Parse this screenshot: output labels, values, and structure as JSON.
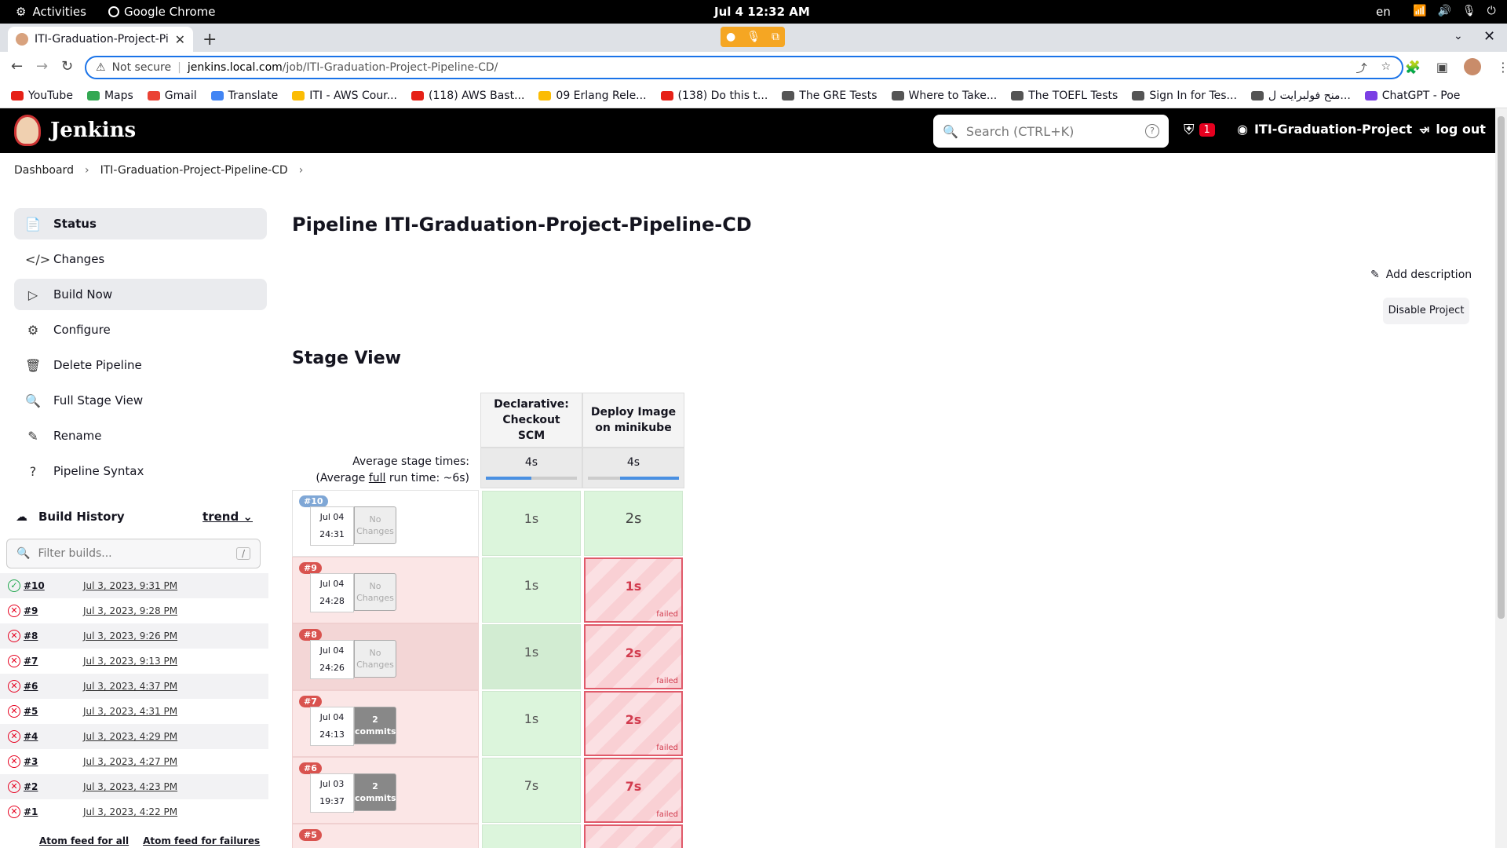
{
  "os_bar": {
    "activities": "Activities",
    "app_name": "Google Chrome",
    "clock": "Jul 4  12:32 AM",
    "lang": "en"
  },
  "browser": {
    "tab_title": "ITI-Graduation-Project-Pi",
    "url_warning": "Not secure",
    "url_host": "jenkins.local.com",
    "url_path": "/job/ITI-Graduation-Project-Pipeline-CD/",
    "bookmarks": [
      {
        "label": "YouTube",
        "color": "#e62117"
      },
      {
        "label": "Maps",
        "color": "#34a853"
      },
      {
        "label": "Gmail",
        "color": "#ea4335"
      },
      {
        "label": "Translate",
        "color": "#4285f4"
      },
      {
        "label": "ITI - AWS Cour...",
        "color": "#fbbc04"
      },
      {
        "label": "(118) AWS Bast...",
        "color": "#e62117"
      },
      {
        "label": "09 Erlang Rele...",
        "color": "#fbbc04"
      },
      {
        "label": "(138) Do this t...",
        "color": "#e62117"
      },
      {
        "label": "The GRE Tests",
        "color": "#555555"
      },
      {
        "label": "Where to Take...",
        "color": "#555555"
      },
      {
        "label": "The TOEFL Tests",
        "color": "#555555"
      },
      {
        "label": "Sign In for Tes...",
        "color": "#555555"
      },
      {
        "label": "منح فولبرايت ل...",
        "color": "#555555"
      },
      {
        "label": "ChatGPT - Poe",
        "color": "#7b3fe4"
      }
    ]
  },
  "jenkins": {
    "brand": "Jenkins",
    "search_placeholder": "Search (CTRL+K)",
    "alert_count": "1",
    "user": "ITI-Graduation-Project",
    "logout": "log out",
    "breadcrumbs": [
      "Dashboard",
      "ITI-Graduation-Project-Pipeline-CD"
    ],
    "tasks": [
      {
        "label": "Status",
        "icon": "📄"
      },
      {
        "label": "Changes",
        "icon": "</>"
      },
      {
        "label": "Build Now",
        "icon": "▷"
      },
      {
        "label": "Configure",
        "icon": "⚙"
      },
      {
        "label": "Delete Pipeline",
        "icon": "🗑"
      },
      {
        "label": "Full Stage View",
        "icon": "🔍"
      },
      {
        "label": "Rename",
        "icon": "✎"
      },
      {
        "label": "Pipeline Syntax",
        "icon": "?"
      }
    ],
    "build_history": {
      "title": "Build History",
      "trend": "trend",
      "filter_placeholder": "Filter builds...",
      "filter_key": "/",
      "builds": [
        {
          "num": "#10",
          "date": "Jul 3, 2023, 9:31 PM",
          "status": "success"
        },
        {
          "num": "#9",
          "date": "Jul 3, 2023, 9:28 PM",
          "status": "failed"
        },
        {
          "num": "#8",
          "date": "Jul 3, 2023, 9:26 PM",
          "status": "failed"
        },
        {
          "num": "#7",
          "date": "Jul 3, 2023, 9:13 PM",
          "status": "failed"
        },
        {
          "num": "#6",
          "date": "Jul 3, 2023, 4:37 PM",
          "status": "failed"
        },
        {
          "num": "#5",
          "date": "Jul 3, 2023, 4:31 PM",
          "status": "failed"
        },
        {
          "num": "#4",
          "date": "Jul 3, 2023, 4:29 PM",
          "status": "failed"
        },
        {
          "num": "#3",
          "date": "Jul 3, 2023, 4:27 PM",
          "status": "failed"
        },
        {
          "num": "#2",
          "date": "Jul 3, 2023, 4:23 PM",
          "status": "failed"
        },
        {
          "num": "#1",
          "date": "Jul 3, 2023, 4:22 PM",
          "status": "failed"
        }
      ],
      "feed_all": "Atom feed for all",
      "feed_failures": "Atom feed for failures"
    },
    "main": {
      "title": "Pipeline ITI-Graduation-Project-Pipeline-CD",
      "add_description": "Add description",
      "disable_project": "Disable Project",
      "stage_view_title": "Stage View",
      "avg_label_1": "Average stage times:",
      "avg_label_2a": "(Average ",
      "avg_label_2b": "full",
      "avg_label_2c": " run time: ~6s)",
      "stages": [
        {
          "name_1": "Declarative:",
          "name_2": "Checkout SCM",
          "avg": "4s"
        },
        {
          "name_1": "Deploy Image",
          "name_2": "on minikube",
          "avg": "4s"
        }
      ],
      "runs": [
        {
          "num": "#10",
          "date": "Jul 04",
          "time": "24:31",
          "chg_1": "No",
          "chg_2": "Changes",
          "commits": false,
          "failed": false,
          "cells": [
            "1s",
            "2s"
          ],
          "fail_label": ""
        },
        {
          "num": "#9",
          "date": "Jul 04",
          "time": "24:28",
          "chg_1": "No",
          "chg_2": "Changes",
          "commits": false,
          "failed": true,
          "cells": [
            "1s",
            "1s"
          ],
          "fail_label": "failed"
        },
        {
          "num": "#8",
          "date": "Jul 04",
          "time": "24:26",
          "chg_1": "No",
          "chg_2": "Changes",
          "commits": false,
          "failed": true,
          "cells": [
            "1s",
            "2s"
          ],
          "fail_label": "failed"
        },
        {
          "num": "#7",
          "date": "Jul 04",
          "time": "24:13",
          "chg_1": "2",
          "chg_2": "commits",
          "commits": true,
          "failed": true,
          "cells": [
            "1s",
            "2s"
          ],
          "fail_label": "failed"
        },
        {
          "num": "#6",
          "date": "Jul 03",
          "time": "19:37",
          "chg_1": "2",
          "chg_2": "commits",
          "commits": true,
          "failed": true,
          "cells": [
            "7s",
            "7s"
          ],
          "fail_label": "failed"
        },
        {
          "num": "#5",
          "date": "",
          "time": "",
          "chg_1": "",
          "chg_2": "",
          "commits": true,
          "failed": true,
          "cells": [
            "",
            ""
          ],
          "fail_label": ""
        }
      ]
    }
  },
  "colors": {
    "success": "#1ea64b",
    "failure": "#e6001f",
    "accent": "#1a73e8"
  }
}
